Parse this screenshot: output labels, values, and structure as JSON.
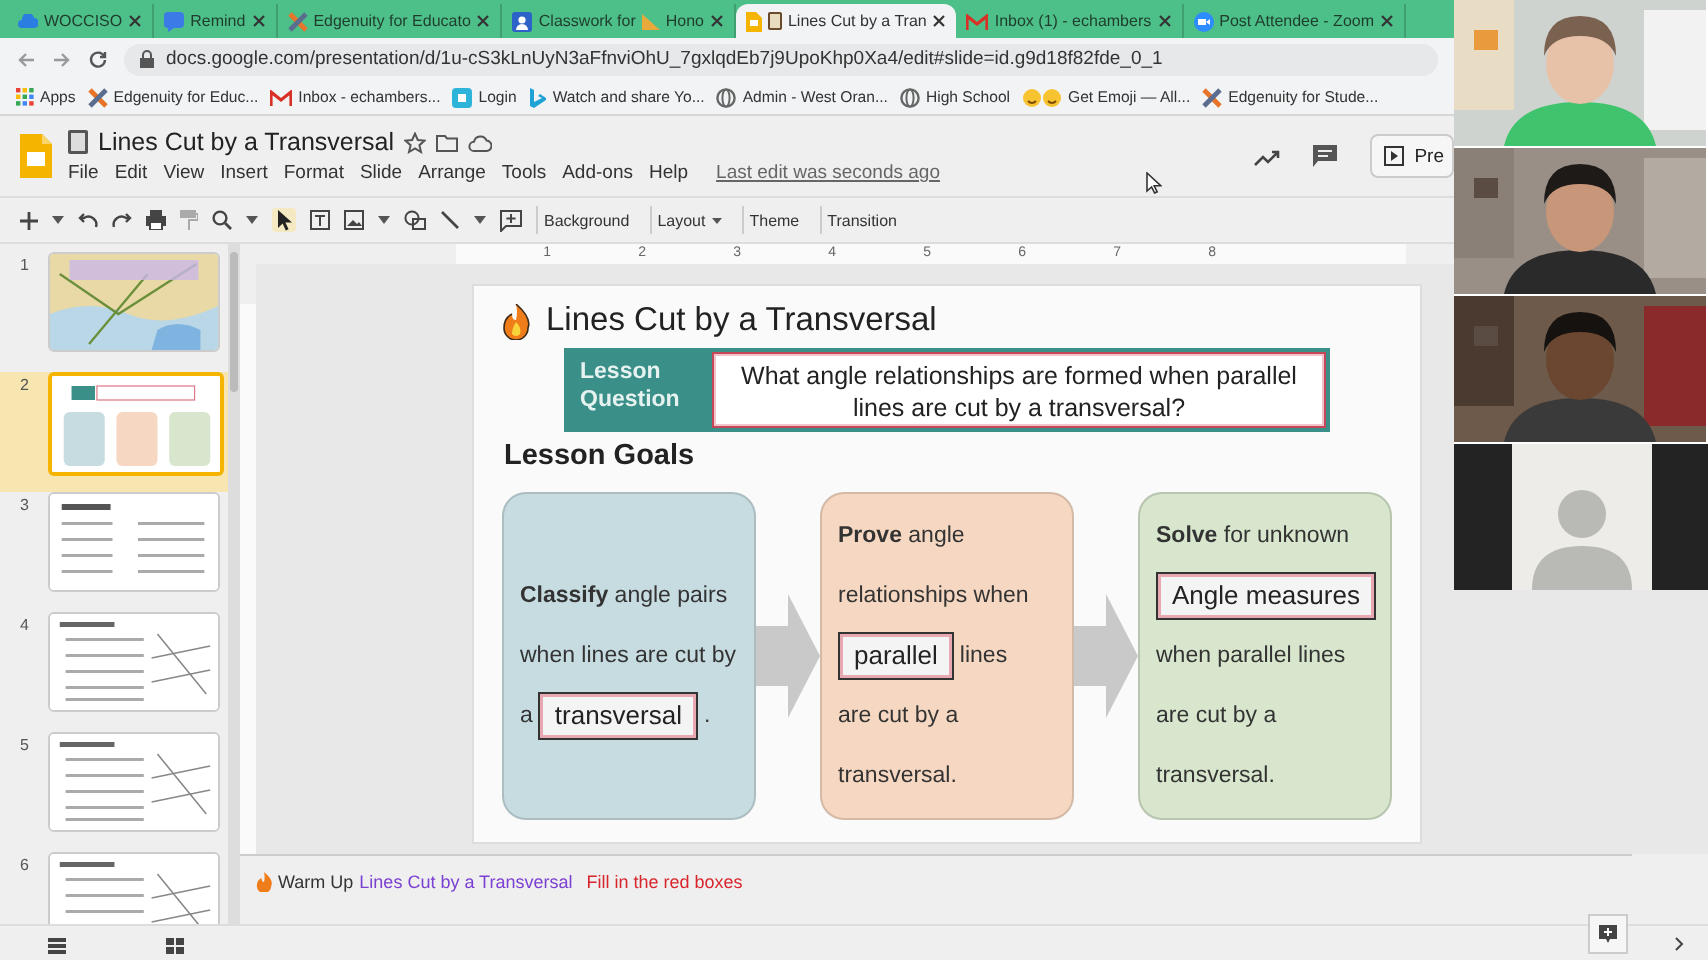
{
  "browser_tabs": [
    {
      "kind": "cloud",
      "label": "WOCCISO",
      "selected": false
    },
    {
      "kind": "chat",
      "label": "Remind",
      "selected": false
    },
    {
      "kind": "cross",
      "label": "Edgenuity for Educato",
      "selected": false
    },
    {
      "kind": "person",
      "label": "Classwork for",
      "label_after": "Hono",
      "selected": false
    },
    {
      "kind": "slides",
      "label": "Lines Cut by a Tran",
      "selected": true
    },
    {
      "kind": "mail",
      "label": "Inbox (1) - echambers",
      "selected": false
    },
    {
      "kind": "video",
      "label": "Post Attendee - Zoom",
      "selected": false
    }
  ],
  "address_bar": {
    "url": "docs.google.com/presentation/d/1u-cS3kLnUyN3aFfnviOhU_7gxlqdEb7j9UpoKhp0Xa4/edit#slide=id.g9d18f82fde_0_1"
  },
  "bookmarks": [
    {
      "kind": "grid",
      "label": "Apps"
    },
    {
      "kind": "cross",
      "label": "Edgenuity for Educ..."
    },
    {
      "kind": "mail",
      "label": "Inbox - echambers..."
    },
    {
      "kind": "square",
      "label": "Login"
    },
    {
      "kind": "bing",
      "label": "Watch and share Yo..."
    },
    {
      "kind": "globe",
      "label": "Admin - West Oran..."
    },
    {
      "kind": "globe",
      "label": "High School"
    },
    {
      "kind": "emoji",
      "label": "Get Emoji — All..."
    },
    {
      "kind": "cross",
      "label": "Edgenuity for Stude..."
    }
  ],
  "document": {
    "title": "Lines Cut by a Transversal",
    "menu": [
      "File",
      "Edit",
      "View",
      "Insert",
      "Format",
      "Slide",
      "Arrange",
      "Tools",
      "Add-ons",
      "Help"
    ],
    "last_edit": "Last edit was seconds ago",
    "present_button": "Pre"
  },
  "toolbar": {
    "buttons": [
      {
        "label": "Background",
        "caret": false
      },
      {
        "label": "Layout",
        "caret": true
      },
      {
        "label": "Theme",
        "caret": false
      },
      {
        "label": "Transition",
        "caret": false
      }
    ]
  },
  "ruler": [
    "1",
    "2",
    "3",
    "4",
    "5",
    "6",
    "7",
    "8"
  ],
  "filmstrip": [
    {
      "number": "1",
      "kind": "map",
      "selected": false
    },
    {
      "number": "2",
      "kind": "goals",
      "selected": true
    },
    {
      "number": "3",
      "kind": "list",
      "selected": false
    },
    {
      "number": "4",
      "kind": "diagram",
      "selected": false
    },
    {
      "number": "5",
      "kind": "diagram",
      "selected": false
    },
    {
      "number": "6",
      "kind": "diagram",
      "selected": false
    }
  ],
  "slide": {
    "title": "Lines Cut by a Transversal",
    "question_label": "Lesson Question",
    "question": "What angle relationships are formed when parallel lines are cut by a transversal?",
    "goals_heading": "Lesson Goals",
    "goals": [
      {
        "color": "#c7dce1",
        "lines": [
          {
            "text": "**Classify** angle pairs"
          },
          {
            "text": "when lines are cut by"
          },
          {
            "before": "a",
            "box": "transversal",
            "after": "."
          }
        ]
      },
      {
        "color": "#f6d8c2",
        "lines": [
          {
            "text": "**Prove** angle"
          },
          {
            "text": "relationships when"
          },
          {
            "box": "parallel",
            "after": "lines"
          },
          {
            "text": "are cut by a"
          },
          {
            "text": "transversal."
          }
        ]
      },
      {
        "color": "#d7e6cc",
        "lines": [
          {
            "text": "**Solve** for unknown"
          },
          {
            "box": "Angle measures"
          },
          {
            "text": "when parallel lines"
          },
          {
            "text": "are cut by a"
          },
          {
            "text": "transversal."
          }
        ]
      }
    ]
  },
  "speaker_notes": [
    {
      "kind": "plain",
      "text": "Warm Up"
    },
    {
      "kind": "link",
      "text": "Lines Cut by a Transversal"
    },
    {
      "kind": "alert",
      "text": "Fill in the red boxes"
    }
  ],
  "video_tiles": [
    {
      "kind": "picture"
    },
    {
      "kind": "picture"
    },
    {
      "kind": "picture"
    },
    {
      "kind": "avatar"
    }
  ]
}
